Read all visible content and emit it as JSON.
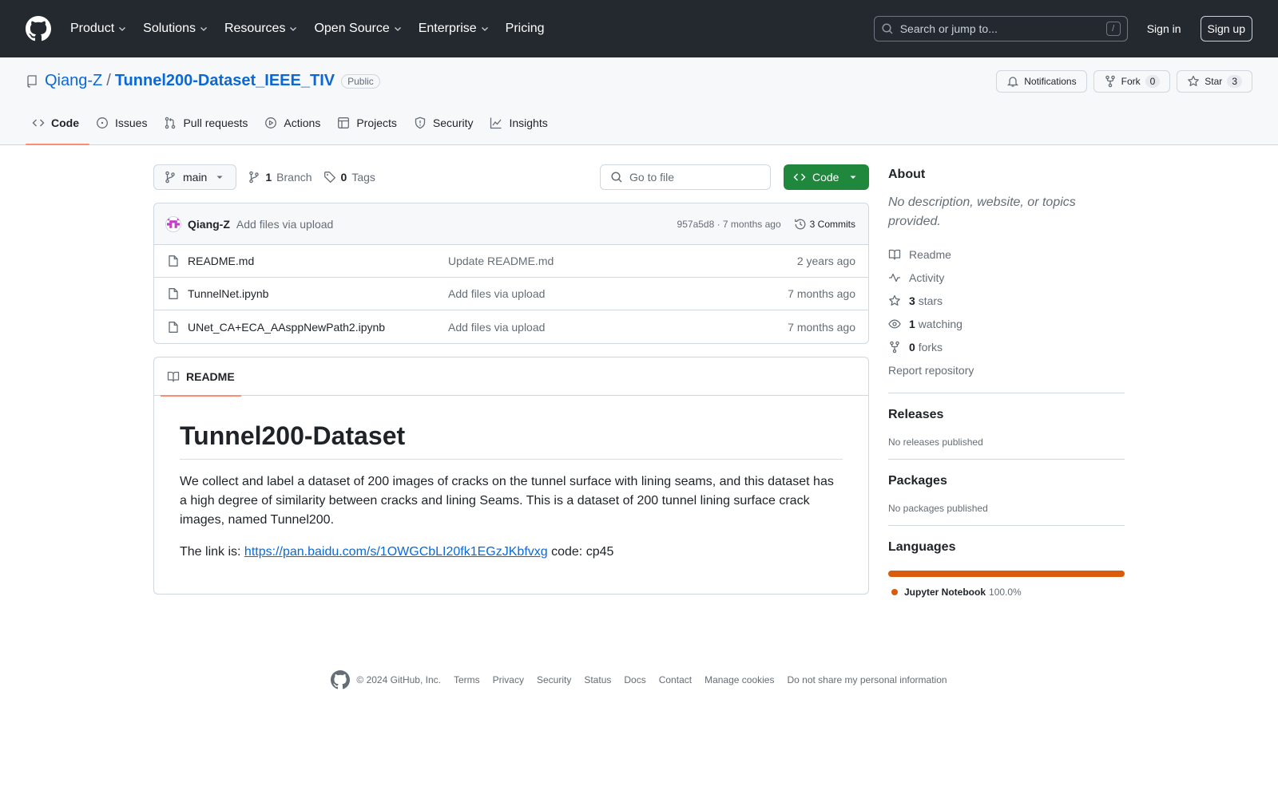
{
  "header": {
    "nav": [
      "Product",
      "Solutions",
      "Resources",
      "Open Source",
      "Enterprise",
      "Pricing"
    ],
    "search_placeholder": "Search or jump to...",
    "search_key": "/",
    "sign_in": "Sign in",
    "sign_up": "Sign up"
  },
  "repo": {
    "owner": "Qiang-Z",
    "separator": "/",
    "name": "Tunnel200-Dataset_IEEE_TIV",
    "visibility": "Public",
    "notifications_label": "Notifications",
    "fork_label": "Fork",
    "fork_count": "0",
    "star_label": "Star",
    "star_count": "3",
    "tabs": [
      "Code",
      "Issues",
      "Pull requests",
      "Actions",
      "Projects",
      "Security",
      "Insights"
    ]
  },
  "toolbar": {
    "branch": "main",
    "branch_count": "1",
    "branch_label": "Branch",
    "tag_count": "0",
    "tag_label": "Tags",
    "goto_placeholder": "Go to file",
    "code_label": "Code"
  },
  "commit": {
    "author": "Qiang-Z",
    "message": "Add files via upload",
    "meta": "957a5d8 · 7 months ago",
    "commits_label": "3 Commits"
  },
  "files": [
    {
      "name": "README.md",
      "message": "Update README.md",
      "time": "2 years ago"
    },
    {
      "name": "TunnelNet.ipynb",
      "message": "Add files via upload",
      "time": "7 months ago"
    },
    {
      "name": "UNet_CA+ECA_AAsppNewPath2.ipynb",
      "message": "Add files via upload",
      "time": "7 months ago"
    }
  ],
  "readme": {
    "tab_label": "README",
    "title": "Tunnel200-Dataset",
    "paragraph": "We collect and label a dataset of 200 images of cracks on the tunnel surface with lining seams, and this dataset has a high degree of similarity between cracks and lining Seams. This is a dataset of 200 tunnel lining surface crack images, named Tunnel200.",
    "link_prefix": "The link is: ",
    "link_url": "https://pan.baidu.com/s/1OWGCbLI20fk1EGzJKbfvxg",
    "link_suffix": " code: cp45"
  },
  "about": {
    "title": "About",
    "description": "No description, website, or topics provided.",
    "readme": "Readme",
    "activity": "Activity",
    "stars_count": "3",
    "stars_label": "stars",
    "watching_count": "1",
    "watching_label": "watching",
    "forks_count": "0",
    "forks_label": "forks",
    "report": "Report repository"
  },
  "releases": {
    "title": "Releases",
    "empty": "No releases published"
  },
  "packages": {
    "title": "Packages",
    "empty": "No packages published"
  },
  "languages": {
    "title": "Languages",
    "name": "Jupyter Notebook",
    "percent": "100.0%",
    "color": "#da5b0b"
  },
  "footer": {
    "copyright": "© 2024 GitHub, Inc.",
    "links": [
      "Terms",
      "Privacy",
      "Security",
      "Status",
      "Docs",
      "Contact",
      "Manage cookies",
      "Do not share my personal information"
    ]
  }
}
